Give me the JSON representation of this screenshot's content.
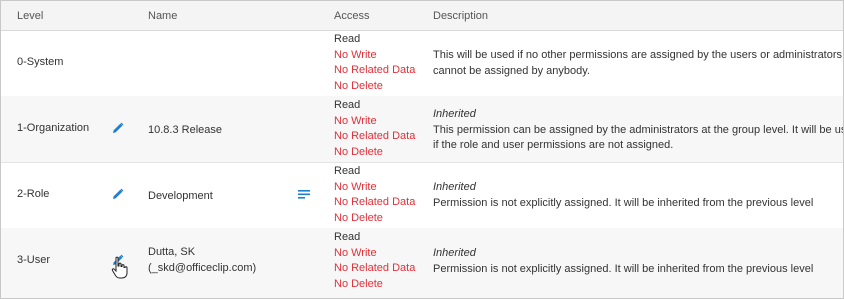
{
  "headers": {
    "level": "Level",
    "name": "Name",
    "access": "Access",
    "description": "Description"
  },
  "access_labels": {
    "read": "Read",
    "no_write": "No Write",
    "no_related_data": "No Related Data",
    "no_delete": "No Delete"
  },
  "rows": [
    {
      "level": "0-System",
      "name_line1": "",
      "name_line2": "",
      "inherited": "",
      "desc_line1": "This will be used if no other permissions are assigned by the users or administrators. It",
      "desc_line2": "cannot be assigned by anybody."
    },
    {
      "level": "1-Organization",
      "name_line1": "10.8.3 Release",
      "name_line2": "",
      "inherited": "Inherited",
      "desc_line1": "This permission can be assigned by the administrators at the group level. It will be used",
      "desc_line2": "if the role and user permissions are not assigned."
    },
    {
      "level": "2-Role",
      "name_line1": "Development",
      "name_line2": "",
      "inherited": "Inherited",
      "desc_line1": "Permission is not explicitly assigned. It will be inherited from the previous level",
      "desc_line2": ""
    },
    {
      "level": "3-User",
      "name_line1": "Dutta, SK",
      "name_line2": "(_skd@officeclip.com)",
      "inherited": "Inherited",
      "desc_line1": "Permission is not explicitly assigned. It will be inherited from the previous level",
      "desc_line2": ""
    }
  ],
  "icons": {
    "edit": "pencil-edit-icon",
    "notes": "notes-list-icon",
    "cursor": "hand-pointer-cursor"
  },
  "colors": {
    "deny": "#e0313a",
    "icon": "#1e7fd1",
    "alt_row": "#f7f7f7",
    "header_bg": "#f4f4f4"
  }
}
